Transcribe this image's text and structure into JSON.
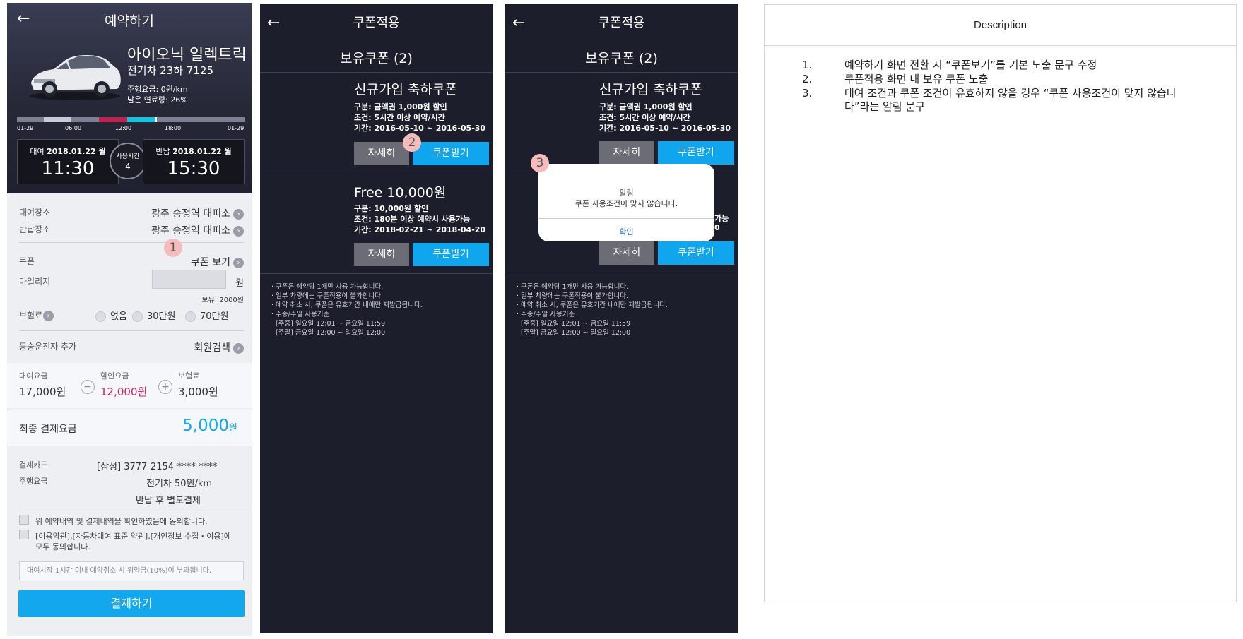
{
  "reservation": {
    "title": "예약하기",
    "car_name": "아이오닉 일렉트릭",
    "car_plate": "전기차  23하 7125",
    "drive_fee": "주행요금: 0원/km",
    "fuel_left": "남은 연료량: 26%",
    "timeline": {
      "labels": [
        "01-29",
        "06:00",
        "12:00",
        "18:00",
        "01-29"
      ],
      "colors": {
        "track": "#7d7f92",
        "booked": "#c0224f",
        "selected": "#11c3e0",
        "light": "#c9c9d6"
      }
    },
    "rental": {
      "label": "대여",
      "date": "2018.01.22 월",
      "time": "11:30"
    },
    "usage": {
      "label": "사용시간",
      "hours": "4"
    },
    "return": {
      "label": "반납",
      "date": "2018.01.22 월",
      "time": "15:30"
    },
    "rental_place": {
      "label": "대여장소",
      "value": "광주 송정역 대피소"
    },
    "return_place": {
      "label": "반납장소",
      "value": "광주 송정역 대피소"
    },
    "coupon": {
      "label": "쿠폰",
      "value": "쿠폰 보기"
    },
    "mileage": {
      "label": "마일리지",
      "unit": "원",
      "balance": "보유: 2000원"
    },
    "insurance": {
      "label": "보험료",
      "options": [
        "없음",
        "30만원",
        "70만원"
      ]
    },
    "co_driver": {
      "label": "동승운전자 추가",
      "value": "회원검색"
    },
    "fees": {
      "rental_label": "대여요금",
      "rental_value": "17,000원",
      "discount_label": "할인요금",
      "discount_value": "12,000원",
      "insurance_label": "보험료",
      "insurance_value": "3,000원",
      "minus": "−",
      "plus": "+"
    },
    "final": {
      "label": "최종 결제요금",
      "value": "5,000",
      "unit": "원"
    },
    "card": {
      "label": "결제카드",
      "value": "[삼성] 3777-2154-****-****"
    },
    "drive_rate": {
      "label": "주행요금",
      "value": "전기차 50원/km",
      "note": "반납 후 별도결제"
    },
    "agree1": "위 예약내역 및 결제내역을 확인하였음에 동의합니다.",
    "agree2_line1": "[이용약관],[자동차대여 표준 약관],[개인정보 수집・이용]에",
    "agree2_line2": "모두 동의합니다.",
    "notice": "대여시작 1시간 이내 예약취소 시 위약금(10%)이 부과됩니다.",
    "pay_button": "결제하기",
    "accent": "#13a7ee",
    "discount_color": "#d0205a"
  },
  "badges": [
    "1",
    "2",
    "3"
  ],
  "coupon_screen": {
    "title": "쿠폰적용",
    "subtitle": "보유쿠폰 (2)",
    "coupons": [
      {
        "name": "신규가입 축하쿠폰",
        "type": "구분: 금액권 1,000원 할인",
        "condition": "조건: 5시간 이상 예약/시간",
        "period": "기간: 2016-05-10 ~ 2016-05-30",
        "detail_label": "자세히",
        "get_label": "쿠폰받기"
      },
      {
        "name": "Free 10,000원",
        "type": "구분: 10,000원 할인",
        "condition": "조건: 180분 이상 예약시 사용가능",
        "period": "기간: 2018-02-21 ~ 2018-04-20",
        "detail_label": "자세히",
        "get_label": "쿠폰받기"
      }
    ],
    "notes": [
      "· 쿠폰은 예약당 1개만 사용 가능합니다.",
      "· 일부 차량에는 쿠폰적용이 불가합니다.",
      "· 예약 취소 시, 쿠폰은 유효기간 내에만 재발급됩니다.",
      "· 주중/주말 사용기준",
      "  [주중] 일요일 12:01 ~ 금요일 11:59",
      "  [주말] 금요일 12:00 ~ 일요일 12:00"
    ],
    "partial_right_1": "가능",
    "partial_right_2": "0",
    "alert": {
      "title": "알림",
      "message": "쿠폰 사용조건이 맞지 않습니다.",
      "ok": "확인"
    }
  },
  "description": {
    "header": "Description",
    "items": [
      {
        "num": "1.",
        "text": "예약하기 화면 전환 시 “쿠폰보기”를 기본 노출 문구 수정"
      },
      {
        "num": "2.",
        "text": "쿠폰적용 화면 내 보유 쿠폰 노출"
      },
      {
        "num": "3.",
        "text": "대여 조건과 쿠폰 조건이 유효하지 않을 경우 “쿠폰 사용조건이 맞지 않습니다”라는 알림 문구"
      }
    ]
  }
}
